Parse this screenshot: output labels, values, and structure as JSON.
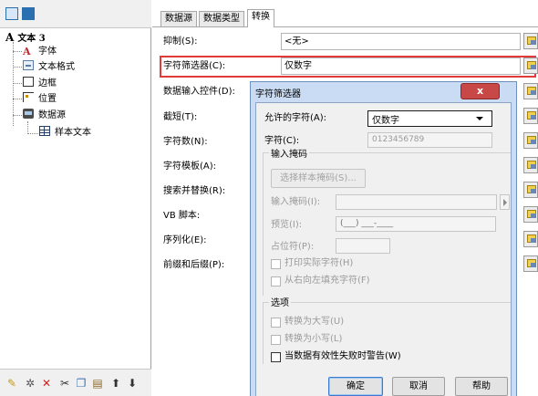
{
  "tree": {
    "root": "文本 3",
    "root_glyph": "A",
    "items": [
      {
        "label": "字体",
        "icon": "font-icon"
      },
      {
        "label": "文本格式",
        "icon": "text-format-icon"
      },
      {
        "label": "边框",
        "icon": "border-icon"
      },
      {
        "label": "位置",
        "icon": "position-icon"
      },
      {
        "label": "数据源",
        "icon": "datasource-icon"
      },
      {
        "label": "样本文本",
        "icon": "table-icon"
      }
    ]
  },
  "tabs": [
    "数据源",
    "数据类型",
    "转换"
  ],
  "active_tab": "转换",
  "properties": [
    {
      "label": "抑制(S):",
      "value": "<无>"
    },
    {
      "label": "字符筛选器(C):",
      "value": "仅数字"
    },
    {
      "label": "数据输入控件(D):",
      "value": ""
    },
    {
      "label": "截短(T):",
      "value": ""
    },
    {
      "label": "字符数(N):",
      "value": ""
    },
    {
      "label": "字符模板(A):",
      "value": ""
    },
    {
      "label": "搜索并替换(R):",
      "value": ""
    },
    {
      "label": "VB 脚本:",
      "value": ""
    },
    {
      "label": "序列化(E):",
      "value": ""
    },
    {
      "label": "前缀和后缀(P):",
      "value": ""
    }
  ],
  "dialog": {
    "title": "字符筛选器",
    "close_label": "x",
    "allowed_label": "允许的字符(A):",
    "allowed_value": "仅数字",
    "chars_label": "字符(C):",
    "chars_value": "0123456789",
    "mask_group": "输入掩码",
    "select_mask_button": "选择样本掩码(S)...",
    "mask_label": "输入掩码(I):",
    "preview_label": "预览(I):",
    "preview_value": "(___) ___-____",
    "placeholder_label": "占位符(P):",
    "print_chars": "打印实际字符(H)",
    "fill_rtl": "从右向左填充字符(F)",
    "options_group": "选项",
    "uppercase": "转换为大写(U)",
    "lowercase": "转换为小写(L)",
    "warn_invalid": "当数据有效性失败时警告(W)",
    "ok": "确定",
    "cancel": "取消",
    "help": "帮助"
  },
  "colors": {
    "highlight": "#e03a3a",
    "dialog_frame": "#c9dcf3",
    "close_button": "#c84848"
  }
}
